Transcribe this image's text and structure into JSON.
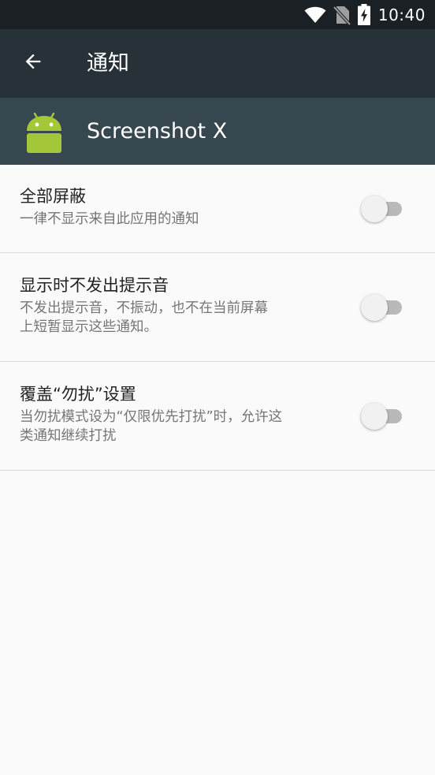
{
  "status_bar": {
    "time": "10:40",
    "icons": [
      "wifi-icon",
      "no-sim-icon",
      "battery-charging-icon"
    ]
  },
  "app_bar": {
    "back_icon": "arrow-back-icon",
    "title": "通知"
  },
  "app_header": {
    "icon": "android-robot-icon",
    "name": "Screenshot X"
  },
  "settings": [
    {
      "title": "全部屏蔽",
      "description": "一律不显示来自此应用的通知",
      "toggle_on": false
    },
    {
      "title": "显示时不发出提示音",
      "description_line1": "不发出提示音，不振动，也不在当前屏幕",
      "description_line2": "上短暂显示这些通知。",
      "toggle_on": false
    },
    {
      "title": "覆盖“勿扰”设置",
      "description_line1": "当勿扰模式设为“仅限优先打扰”时，允许这",
      "description_line2": "类通知继续打扰",
      "toggle_on": false
    }
  ],
  "colors": {
    "status_bar": "#1a2024",
    "app_bar": "#263238",
    "app_header": "#37474f",
    "android_green": "#a4c639",
    "background": "#fafafa"
  }
}
